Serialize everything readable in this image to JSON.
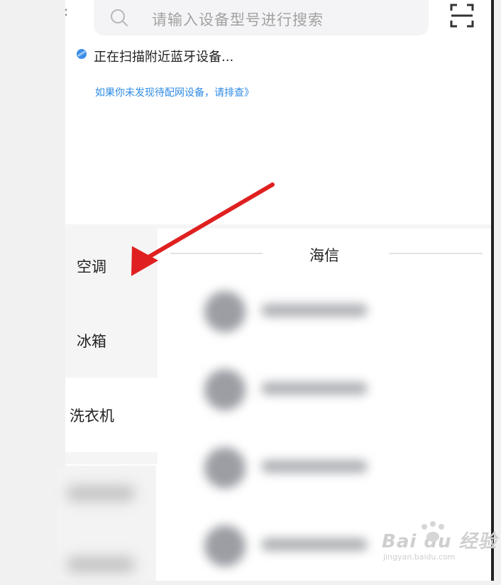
{
  "search": {
    "placeholder": "请输入设备型号进行搜索",
    "back_glyph": ":"
  },
  "scan": {
    "status_text": "正在扫描附近蓝牙设备...",
    "help_link": "如果你未发现待配网设备，请排查》"
  },
  "categories": [
    {
      "label": "空调"
    },
    {
      "label": "冰箱"
    },
    {
      "label": "洗衣机"
    }
  ],
  "brand": {
    "title": "海信"
  },
  "watermark": {
    "logo": "Bai du 经验",
    "subtitle": "jingyan.baidu.com"
  },
  "colors": {
    "link": "#2f8be6",
    "annotation_arrow": "#e02020",
    "bluetooth_icon": "#3d8ee8"
  },
  "icons": [
    "search-icon",
    "scan-icon",
    "bluetooth-icon",
    "annotation-arrow"
  ]
}
